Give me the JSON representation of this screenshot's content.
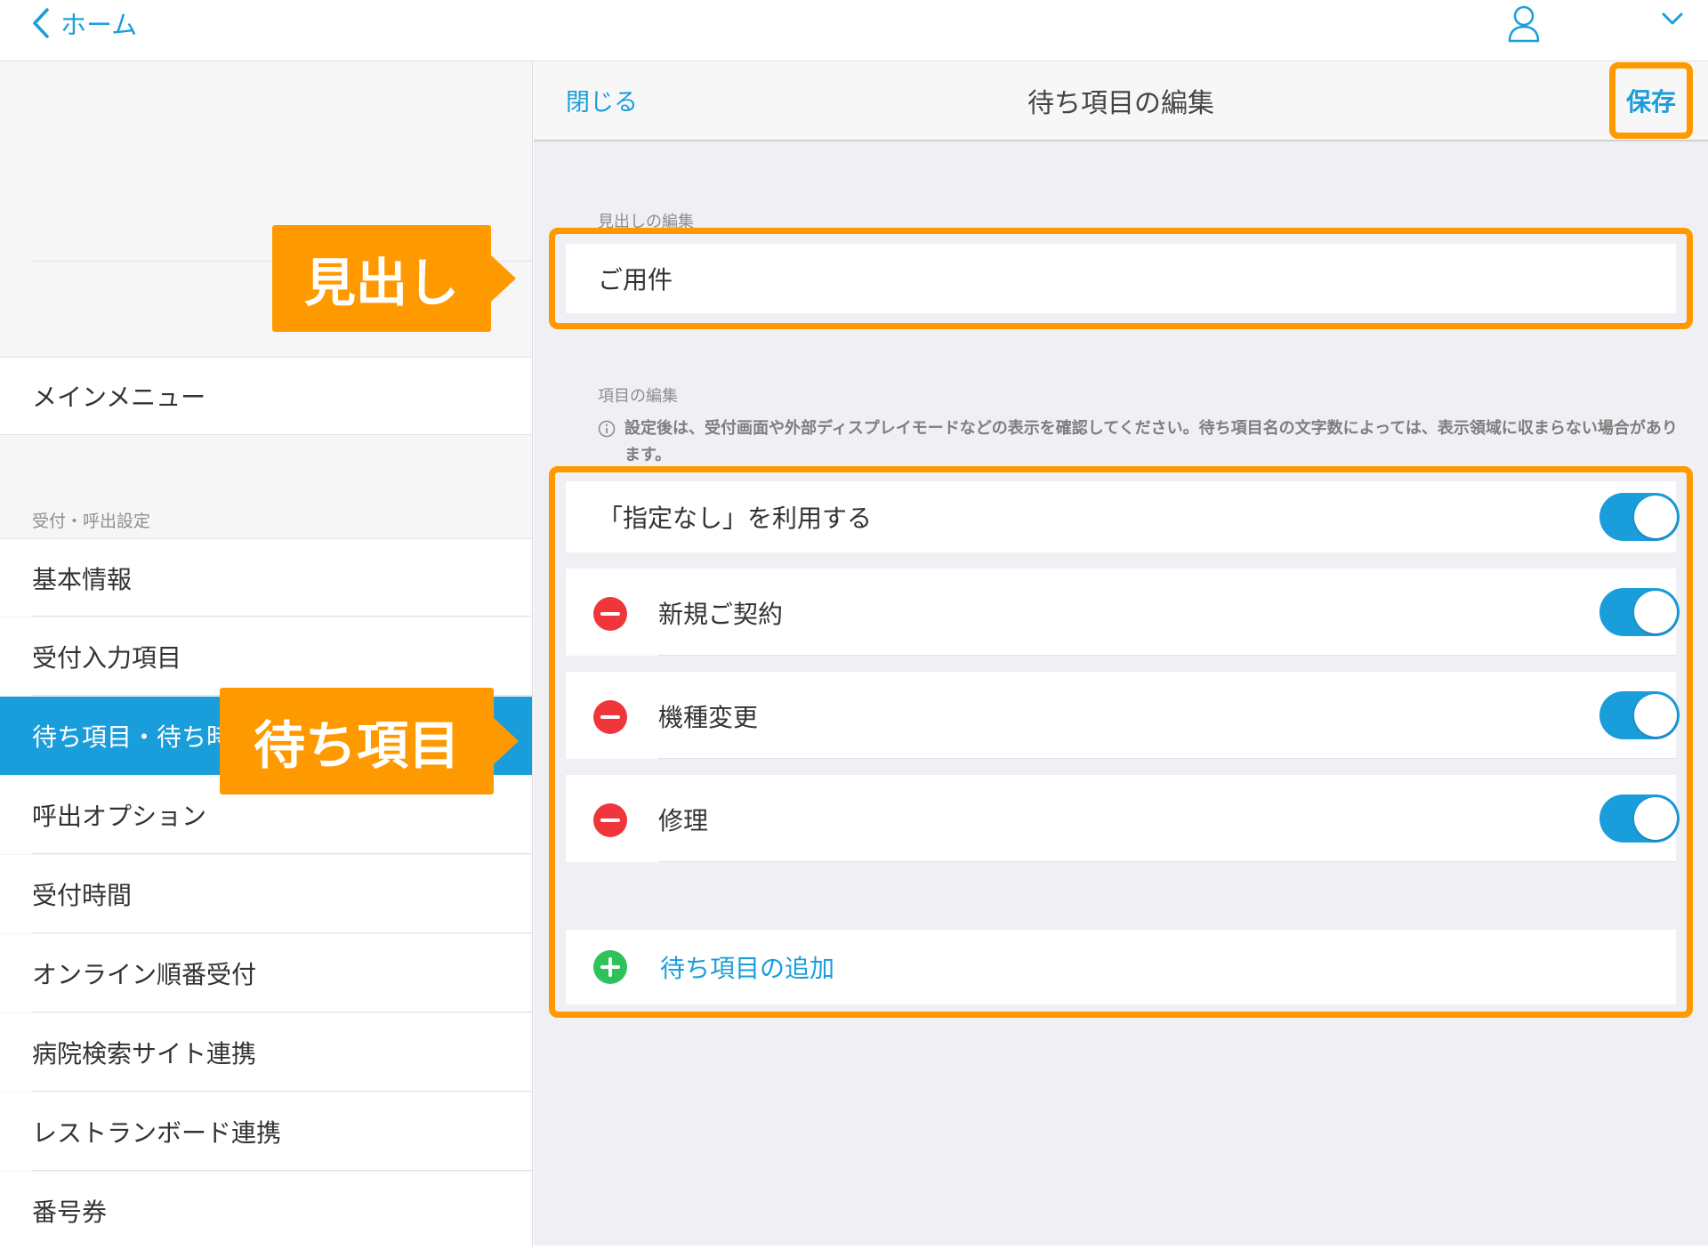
{
  "topbar": {
    "back_label": "ホーム"
  },
  "sidebar": {
    "main_menu": "メインメニュー",
    "section_title": "受付・呼出設定",
    "items": [
      {
        "label": "基本情報"
      },
      {
        "label": "受付入力項目"
      },
      {
        "label": "待ち項目・待ち時間",
        "active": true
      },
      {
        "label": "呼出オプション"
      },
      {
        "label": "受付時間"
      },
      {
        "label": "オンライン順番受付"
      },
      {
        "label": "病院検索サイト連携"
      },
      {
        "label": "レストランボード連携"
      },
      {
        "label": "番号券"
      }
    ]
  },
  "panel": {
    "close_label": "閉じる",
    "title": "待ち項目の編集",
    "save_label": "保存",
    "heading_section": "見出しの編集",
    "heading_value": "ご用件",
    "items_section": "項目の編集",
    "note": "設定後は、受付画面や外部ディスプレイモードなどの表示を確認してください。待ち項目名の文字数によっては、表示領域に収まらない場合があります。",
    "no_preference_label": "「指定なし」を利用する",
    "no_preference_on": true,
    "wait_items": [
      {
        "label": "新規ご契約",
        "enabled": true
      },
      {
        "label": "機種変更",
        "enabled": true
      },
      {
        "label": "修理",
        "enabled": true
      }
    ],
    "add_label": "待ち項目の追加"
  },
  "annotations": {
    "heading_callout": "見出し",
    "items_callout": "待ち項目"
  },
  "colors": {
    "accent": "#1a9edb",
    "highlight": "#ff9900",
    "delete": "#f0353b",
    "add": "#2fc25b"
  }
}
